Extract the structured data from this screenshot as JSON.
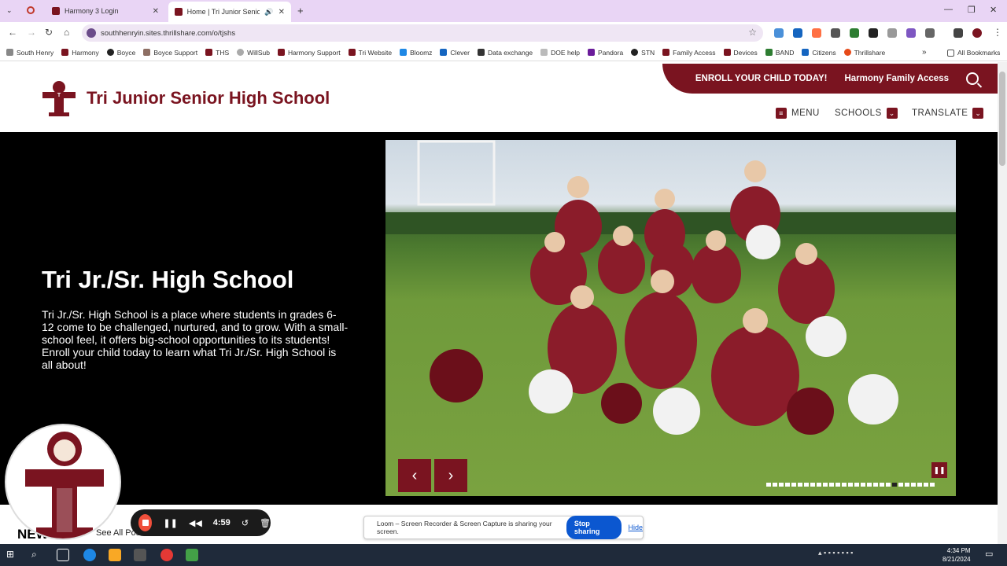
{
  "browser": {
    "tabs": [
      {
        "title": "Harmony 3 Login",
        "active": false
      },
      {
        "title": "Home | Tri Junior Senior Hig",
        "active": true
      }
    ],
    "url": "southhenryin.sites.thrillshare.com/o/tjshs",
    "bookmarks": [
      "South Henry",
      "Harmony",
      "Boyce",
      "Boyce Support",
      "THS",
      "WillSub",
      "Harmony Support",
      "Tri Website",
      "Bloomz",
      "Clever",
      "Data exchange",
      "DOE help",
      "Pandora",
      "STN",
      "Family Access",
      "Devices",
      "BAND",
      "Citizens",
      "Thrillshare"
    ],
    "all_bookmarks": "All Bookmarks"
  },
  "site": {
    "school_name": "Tri Junior Senior High School",
    "topbar": {
      "enroll": "ENROLL YOUR CHILD TODAY!",
      "family_access": "Harmony Family Access"
    },
    "nav": {
      "menu": "MENU",
      "schools": "SCHOOLS",
      "translate": "TRANSLATE"
    },
    "hero": {
      "title": "Tri Jr./Sr. High School",
      "text": "Tri Jr./Sr. High School is a place where students in grades 6-12 come to be challenged, nurtured, and to grow. With a small-school feel, it offers big-school opportunities to its students! Enroll your child today to learn what Tri Jr./Sr. High School is all about!"
    },
    "news": {
      "title": "NEWS",
      "see_all": "See All Posts"
    },
    "colors": {
      "brand": "#7a1420"
    }
  },
  "loom": {
    "timer": "4:59",
    "share_message": "Loom – Screen Recorder & Screen Capture is sharing your screen.",
    "stop_label": "Stop sharing",
    "hide_label": "Hide"
  },
  "taskbar": {
    "time": "4:34 PM",
    "date": "8/21/2024"
  }
}
